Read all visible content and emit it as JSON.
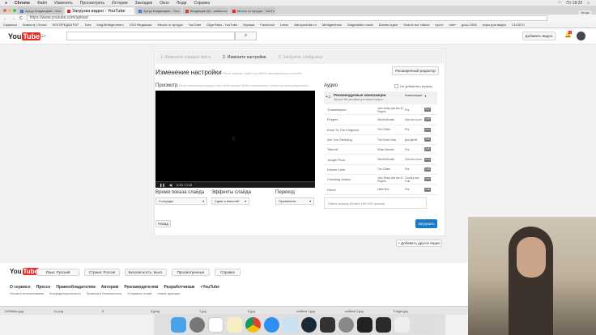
{
  "menubar": {
    "app": "Chrome",
    "items": [
      "Файл",
      "Изменить",
      "Просмотреть",
      "История",
      "Закладки",
      "Окно",
      "Люди",
      "Справка"
    ],
    "clock": "Пт 18:20"
  },
  "tabs": [
    "Артур Богдасарян - Goo",
    "Загрузка видео - YouTube",
    "Артур Богдасарян - Goo",
    "Входящие (6) - ambiencc",
    "Месси от Артура - YouTu"
  ],
  "address": {
    "url": "https://www.youtube.com/upload",
    "user": "Игорь"
  },
  "bookmarks": [
    "Сервисы",
    "Новости | Gorod",
    "ФОТОРЕДАКТОР",
    "Тата",
    "blog.MrIdigentmen",
    "VSO Вездешки",
    "Месси от Артура",
    "YouTube",
    "Olga Rass - YouTube",
    "Музыка",
    "Facebook",
    "Learn",
    "Автоyoutube.ru",
    "MrIdigentmen",
    "Magnolistic music",
    "Бизнес идеи",
    "Search our videos",
    "пусто",
    "инет",
    "дочь 2008",
    "серы для видео",
    "CLEATO"
  ],
  "header": {
    "logo": "You",
    "logo2": "Tube",
    "region": "RU",
    "upload_button": "Добавить видео",
    "notif_count": "4"
  },
  "steps": [
    "1. Измените порядок фото.",
    "2. Измените настройки.",
    "3. Загрузите слайд-шоу."
  ],
  "settings": {
    "title": "Изменение настройки",
    "title_hint": "После загрузки слайд-шоу будет автоматически на видео",
    "advanced_editor": "Расширенный редактор",
    "preview_label": "Просмотр",
    "preview_hint": "После завершения загрузки это видео может будет посмотреть в более высоком разрешении",
    "player_time": "0:00 / 0:18"
  },
  "controls": {
    "duration_label": "Время показа слайда",
    "duration_value": "3 секунды",
    "effects_label": "Эффекты слайда",
    "effects_value": "Сдвиг и масштаб",
    "transition_label": "Переход",
    "transition_value": "Проявление"
  },
  "audio": {
    "label": "Аудио",
    "no_music": "Не добавлять музыку",
    "rec_title": "Рекомендуемые композиции",
    "rec_sub": "Музыка без рекламы для вашего видео",
    "category": "Композиции",
    "search_placeholder": "Найти музыку (более 150 000 треков)",
    "songs": [
      {
        "title": "Transmission",
        "artist": "John Deley and the 41 Players",
        "genre": "Рок",
        "dur": "2:11"
      },
      {
        "title": "Fingers",
        "artist": "Otis McDonald",
        "genre": "Хип-хоп и рэп",
        "dur": "1:55"
      },
      {
        "title": "Keys To The Kingdom",
        "artist": "The 126ers",
        "genre": "Рок",
        "dur": "3:42"
      },
      {
        "title": "Are You Sleeping",
        "artist": "The Green Orbs",
        "genre": "Для детей",
        "dur": "2:04"
      },
      {
        "title": "Takeoff",
        "artist": "Ethan Meixsell",
        "genre": "Рок",
        "dur": "2:46"
      },
      {
        "title": "Jungle Floor",
        "artist": "Otis McDonald",
        "genre": "Хип-хоп и рэп",
        "dur": "2:09"
      },
      {
        "title": "Dream Land",
        "artist": "The 126ers",
        "genre": "Рок",
        "dur": "2:34"
      },
      {
        "title": "Cheating Juarez",
        "artist": "John Deley and the 41 Players",
        "genre": "Country and Folk",
        "dur": "2:07"
      },
      {
        "title": "Home",
        "artist": "Letter Box",
        "genre": "Рок",
        "dur": "2:39"
      }
    ]
  },
  "actions": {
    "back": "Назад",
    "upload": "Загрузить",
    "add_other": "+ Добавить другое видео"
  },
  "footer": {
    "language": "Язык: Русский",
    "country": "Страна: Россия",
    "safety": "Безопасность: выкл.",
    "history": "Просмотренные",
    "help": "Справка",
    "links": [
      "О сервисе",
      "Прессе",
      "Правообладателям",
      "Авторам",
      "Рекламодателям",
      "Разработчикам",
      "+YouTube"
    ],
    "links2": [
      "Условия использования",
      "Конфиденциальность",
      "Правила и безопасность",
      "Отправить отзыв",
      "Новые функции"
    ]
  },
  "downloads": [
    "DV8b5cd.jpg",
    "11.png",
    "9",
    "3.jpeg",
    "7.jpg",
    "6.jpg",
    "untitled 1.jpg",
    "untitled 1.jpg",
    "Folger.jpg"
  ],
  "colors": {
    "brand": "#e52d27",
    "upload": "#167ac6"
  }
}
